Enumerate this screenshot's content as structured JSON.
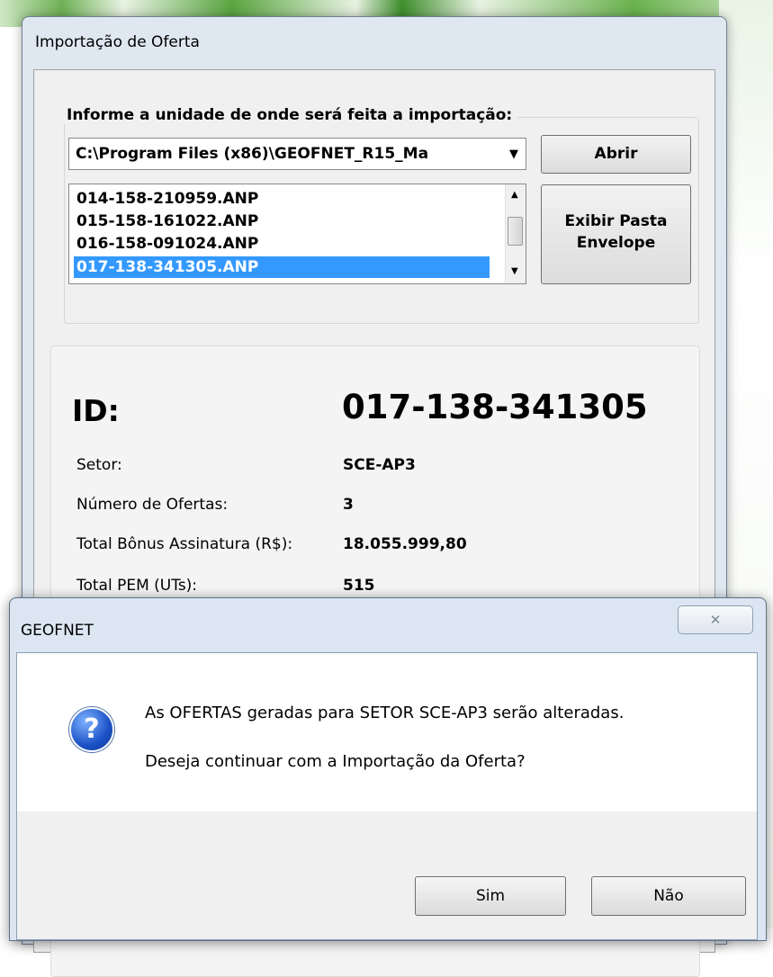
{
  "window": {
    "title": "Importação de Oferta",
    "group_label": "Informe a unidade de onde será feita a importação:",
    "drive_combo": {
      "value": "C:\\Program Files (x86)\\GEOFNET_R15_Ma"
    },
    "buttons": {
      "open": "Abrir",
      "show_folder": "Exibir Pasta Envelope"
    },
    "files": [
      {
        "name": "014-158-210959.ANP",
        "selected": false
      },
      {
        "name": "015-158-161022.ANP",
        "selected": false
      },
      {
        "name": "016-158-091024.ANP",
        "selected": false
      },
      {
        "name": "017-138-341305.ANP",
        "selected": true
      }
    ],
    "details": {
      "id_label": "ID:",
      "id_value": "017-138-341305",
      "fields": [
        {
          "label": "Setor:",
          "value": "SCE-AP3"
        },
        {
          "label": "Número de Ofertas:",
          "value": "3"
        },
        {
          "label": "Total Bônus Assinatura (R$):",
          "value": "18.055.999,80"
        },
        {
          "label": "Total PEM (UTs):",
          "value": "515"
        }
      ]
    }
  },
  "dialog": {
    "title": "GEOFNET",
    "icon": "question-icon",
    "message_line1": "As OFERTAS geradas para SETOR SCE-AP3 serão alteradas.",
    "message_line2": "Deseja continuar com a Importação da Oferta?",
    "buttons": {
      "yes": "Sim",
      "no": "Não"
    }
  },
  "colors": {
    "selection": "#3399ff",
    "dialog_frame": "#dbe6f2"
  }
}
